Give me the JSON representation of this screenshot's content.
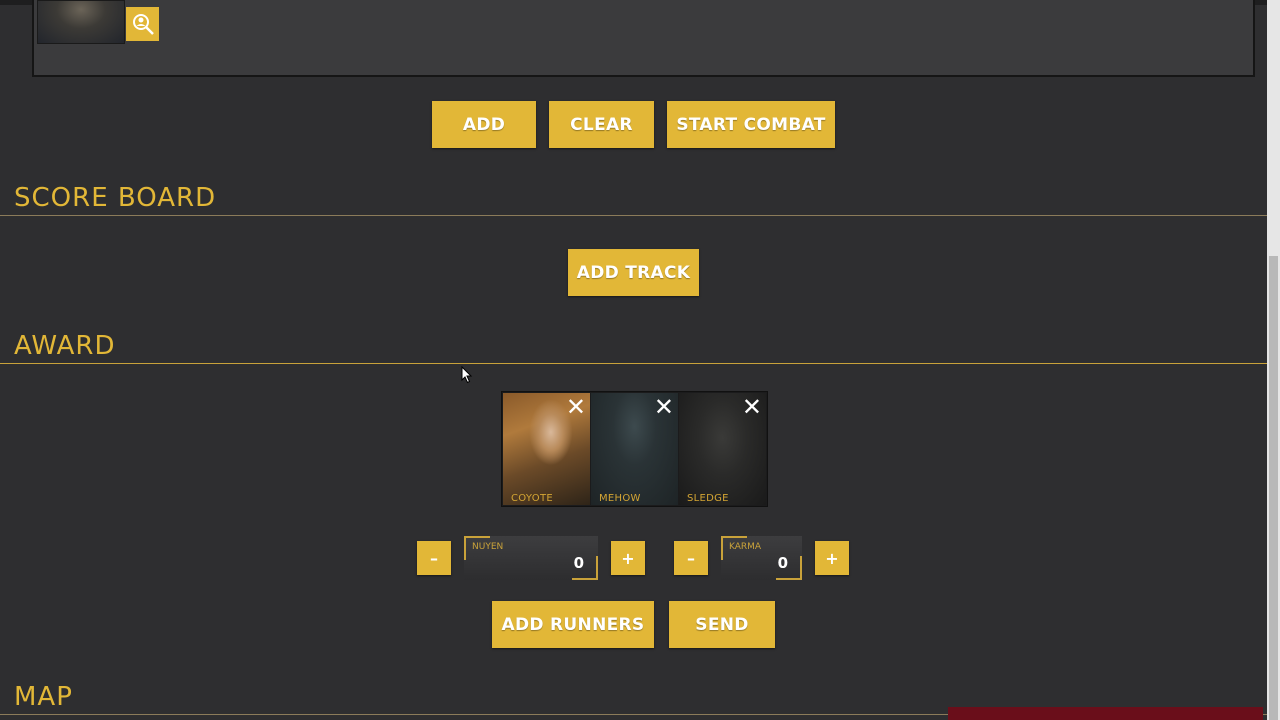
{
  "combat_controls": {
    "add_label": "ADD",
    "clear_label": "CLEAR",
    "start_combat_label": "START COMBAT"
  },
  "score_board": {
    "title": "SCORE BOARD",
    "add_track_label": "ADD TRACK"
  },
  "award": {
    "title": "AWARD",
    "runners": [
      {
        "name": "COYOTE",
        "remove": "✕"
      },
      {
        "name": "MEHOW",
        "remove": "✕"
      },
      {
        "name": "SLEDGE",
        "remove": "✕"
      }
    ],
    "nuyen": {
      "label": "NUYEN",
      "value": "0",
      "minus": "–",
      "plus": "+"
    },
    "karma": {
      "label": "KARMA",
      "value": "0",
      "minus": "–",
      "plus": "+"
    },
    "add_runners_label": "ADD RUNNERS",
    "send_label": "SEND"
  },
  "map": {
    "title": "MAP"
  },
  "colors": {
    "accent": "#e2b737",
    "background": "#2e2e30",
    "panel": "#3b3b3d"
  }
}
